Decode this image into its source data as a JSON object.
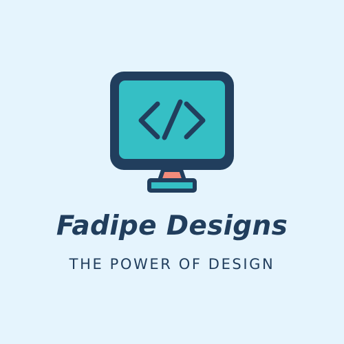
{
  "logo": {
    "icon": "monitor-code-icon",
    "brand_name": "Fadipe Designs",
    "tagline": "THE POWER OF DESIGN"
  },
  "colors": {
    "background": "#e5f4fd",
    "outline": "#213e5d",
    "screen": "#35bfc5",
    "stand": "#f38b7b",
    "text": "#213e5d"
  }
}
